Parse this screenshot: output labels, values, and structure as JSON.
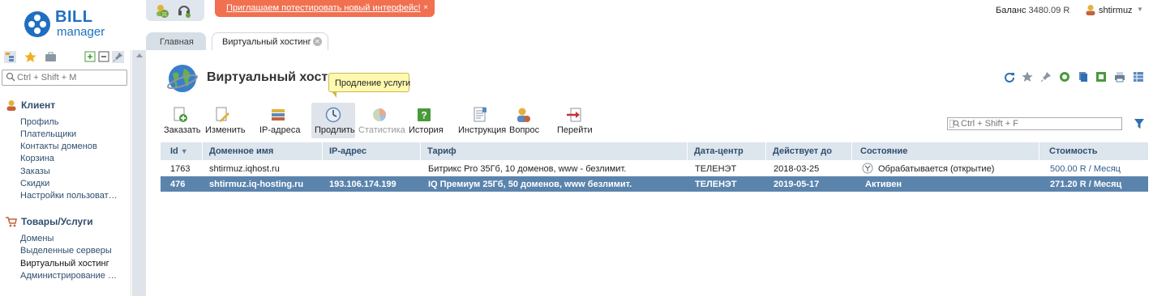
{
  "logo": {
    "bill": "BILL",
    "manager": "manager"
  },
  "notifications": {
    "badge_count": "31"
  },
  "promo": {
    "text": "Приглашаем потестировать новый интерфейс!",
    "close": "×"
  },
  "account": {
    "balance_label": "Баланс",
    "balance_value": "3480.09 R",
    "username": "shtirmuz"
  },
  "tabs": [
    {
      "label": "Главная"
    },
    {
      "label": "Виртуальный хостинг"
    }
  ],
  "sidebar": {
    "search_placeholder": "Ctrl + Shift + M",
    "groups": [
      {
        "title": "Клиент",
        "items": [
          "Профиль",
          "Плательщики",
          "Контакты доменов",
          "Корзина",
          "Заказы",
          "Скидки",
          "Настройки пользоват…"
        ]
      },
      {
        "title": "Товары/Услуги",
        "items": [
          "Домены",
          "Выделенные серверы",
          "Виртуальный хостинг",
          "Администрирование …"
        ]
      }
    ]
  },
  "main": {
    "title": "Виртуальный хостинг",
    "tooltip": "Продление услуги",
    "filter_placeholder": "Ctrl + Shift + F",
    "toolbar": [
      {
        "label": "Заказать",
        "icon": "order-icon"
      },
      {
        "label": "Изменить",
        "icon": "edit-icon"
      },
      {
        "label": "IP-адреса",
        "icon": "ip-icon"
      },
      {
        "label": "Продлить",
        "icon": "renew-icon"
      },
      {
        "label": "Статистика",
        "icon": "stats-icon"
      },
      {
        "label": "История",
        "icon": "history-icon"
      },
      {
        "label": "Инструкция",
        "icon": "instruction-icon"
      },
      {
        "label": "Вопрос",
        "icon": "question-icon"
      },
      {
        "label": "Перейти",
        "icon": "goto-icon"
      }
    ],
    "table": {
      "columns": [
        "Id",
        "Доменное имя",
        "IP-адрес",
        "Тариф",
        "Дата-центр",
        "Действует до",
        "Состояние",
        "Стоимость"
      ],
      "rows": [
        {
          "id": "1763",
          "domain": "shtirmuz.iqhost.ru",
          "ip": "",
          "tariff": "Битрикс Pro 35Гб, 10 доменов, www - безлимит.",
          "dc": "ТЕЛЕНЭТ",
          "until": "2018-03-25",
          "status": "Обрабатывается (открытие)",
          "price": "500.00 R / Месяц"
        },
        {
          "id": "476",
          "domain": "shtirmuz.iq-hosting.ru",
          "ip": "193.106.174.199",
          "tariff": "IQ Премиум 25Гб, 50 доменов, www безлимит.",
          "dc": "ТЕЛЕНЭТ",
          "until": "2019-05-17",
          "status": "Активен",
          "price": "271.20 R / Месяц"
        }
      ]
    }
  },
  "colors": {
    "brand": "#1f6fc0",
    "promo": "#f07050",
    "selected_row": "#5b84ad",
    "header_bg": "#dde5ed",
    "link": "#2f4e6e"
  }
}
